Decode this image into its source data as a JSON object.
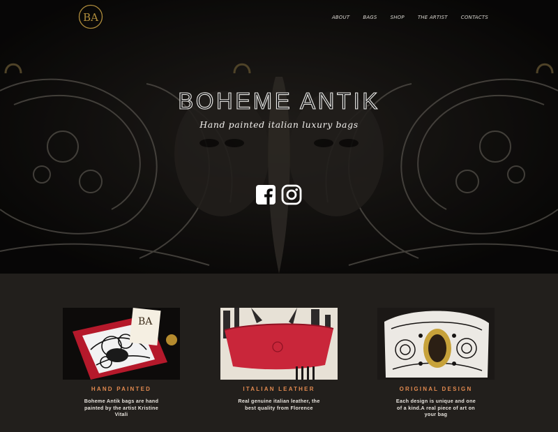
{
  "brand": {
    "logo_text": "BA",
    "name": "BOHEME ANTIK"
  },
  "nav": {
    "items": [
      {
        "label": "ABOUT"
      },
      {
        "label": "BAGS"
      },
      {
        "label": "SHOP"
      },
      {
        "label": "THE ARTIST"
      },
      {
        "label": "CONTACTS"
      }
    ]
  },
  "hero": {
    "title": "BOHEME ANTIK",
    "subtitle": "Hand painted italian luxury bags",
    "social": [
      {
        "icon": "facebook-icon"
      },
      {
        "icon": "instagram-icon"
      }
    ]
  },
  "features": [
    {
      "title": "HAND PAINTED",
      "text": "Boheme Antik bags are hand painted by the artist Kristine Vitali"
    },
    {
      "title": "ITALIAN LEATHER",
      "text": "Real genuine italian leather, the best quality from Florence"
    },
    {
      "title": "ORIGINAL DESIGN",
      "text": "Each design is unique and one of a kind.A real piece of art on your bag"
    }
  ],
  "colors": {
    "accent": "#e0894f",
    "logo_gold": "#b08d3c",
    "hero_bg": "#0a0908",
    "section_bg": "#221f1c",
    "leather_red": "#c9263a"
  }
}
